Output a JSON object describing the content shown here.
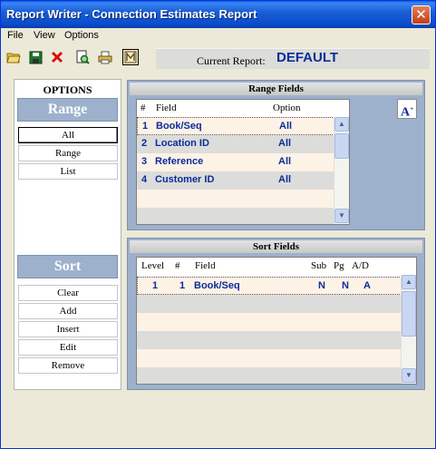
{
  "window": {
    "title": "Report Writer - Connection Estimates Report",
    "close_glyph": "✕"
  },
  "menu": [
    "File",
    "View",
    "Options"
  ],
  "toolbar": {
    "icons": [
      "open-folder-icon",
      "save-disk-icon",
      "delete-x-icon",
      "preview-icon",
      "print-icon",
      "report-icon"
    ],
    "current_report_label": "Current Report:",
    "current_report_value": "DEFAULT"
  },
  "options": {
    "title": "OPTIONS",
    "range_header": "Range",
    "range_buttons": [
      "All",
      "Range",
      "List"
    ],
    "sort_header": "Sort",
    "sort_buttons": [
      "Clear",
      "Add",
      "Insert",
      "Edit",
      "Remove"
    ]
  },
  "range_fields": {
    "title": "Range  Fields",
    "columns": [
      "#",
      "Field",
      "Option"
    ],
    "rows": [
      {
        "num": "1",
        "field": "Book/Seq",
        "option": "All"
      },
      {
        "num": "2",
        "field": "Location ID",
        "option": "All"
      },
      {
        "num": "3",
        "field": "Reference",
        "option": "All"
      },
      {
        "num": "4",
        "field": "Customer ID",
        "option": "All"
      }
    ]
  },
  "font_button": {
    "glyph": "A"
  },
  "sort_fields": {
    "title": "Sort Fields",
    "columns": [
      "Level",
      "#",
      "Field",
      "Sub",
      "Pg",
      "A/D"
    ],
    "rows": [
      {
        "level": "1",
        "num": "1",
        "field": "Book/Seq",
        "sub": "N",
        "pg": "N",
        "ad": "A"
      }
    ]
  },
  "colors": {
    "accent": "#0b2c9a",
    "panel": "#9db1cc",
    "row_alt": "#dcdcda",
    "row_cream": "#fdf2e6"
  }
}
